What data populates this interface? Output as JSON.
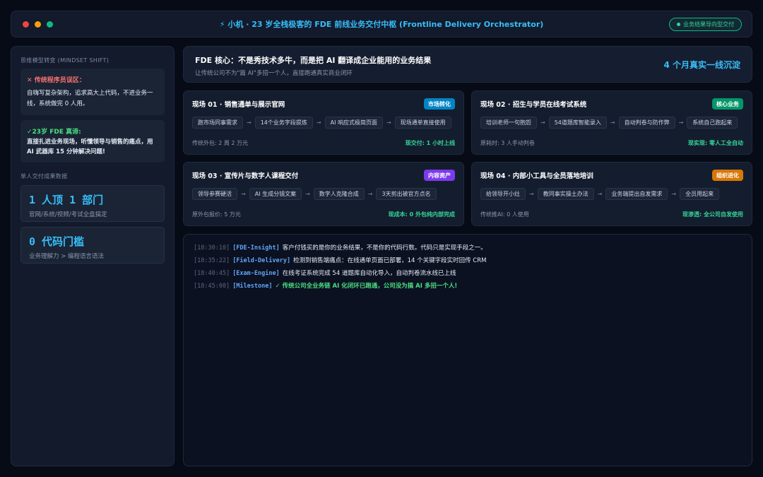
{
  "titlebar": {
    "dot_colors": [
      "#ef4444",
      "#f59e0b",
      "#10b981"
    ],
    "title": "小机 · 23 岁全栈极客的 FDE 前线业务交付中枢 (Frontline Delivery Orchestrator)",
    "title_icon": "lightning-icon",
    "badge": "业务结果导向型交付"
  },
  "sidebar": {
    "mindset_label": "思维模型转变 (MINDSET SHIFT)",
    "myth_title": "传统程序员误区：",
    "myth_body": "自嗨写复杂架构，追求高大上代码，不进业务一线，系统做完 0 人用。",
    "truth_title": "23岁 FDE 真谛:",
    "truth_body": "直接扎进业务现场，听懂领导与销售的痛点，用 AI 武器库 15 分钟解决问题!",
    "stats_label": "单人交付成果数据",
    "stats": [
      {
        "value": "1 人顶 1 部门",
        "sub": "官网/系统/视频/考试全盘搞定"
      },
      {
        "value": "0 代码门槛",
        "sub": "业务理解力 > 编程语言语法"
      }
    ]
  },
  "banner": {
    "title": "FDE 核心：不是秀技术多牛，而是把 AI 翻译成企业能用的业务结果",
    "subtitle": "让传统公司不为\"篇 AI\"多招一个人，直接跑通真实商业闭环",
    "right": "4 个月真实一线沉淀"
  },
  "cards": [
    {
      "title": "现场 01 · 销售通单与展示官网",
      "tag": "市场转化",
      "tag_color": "#0284c7",
      "steps": [
        "跑市场同事需求",
        "14个业务字段提炼",
        "AI 响应式极简页面",
        "现场通单直接使用"
      ],
      "foot_left": "传统外包: 2 周 2 万元",
      "foot_right": "现交付: 1 小时上线"
    },
    {
      "title": "现场 02 · 招生与学员在线考试系统",
      "tag": "核心业务",
      "tag_color": "#059669",
      "steps": [
        "培训老师一句抱怨",
        "54道题库智能录入",
        "自动判卷与防作弊",
        "系统自己跑起来"
      ],
      "foot_left": "原耗时: 3 人手动判卷",
      "foot_right": "现实现: 零人工全自动"
    },
    {
      "title": "现场 03 · 宣传片与数字人课程交付",
      "tag": "内容资产",
      "tag_color": "#7c3aed",
      "steps": [
        "领导参赛硬活",
        "AI 生成分镜文案",
        "数字人克隆合成",
        "3天剪出被官方点名"
      ],
      "foot_left": "原外包报价: 5 万元",
      "foot_right": "现成本: 0 外包纯内部完成"
    },
    {
      "title": "现场 04 · 内部小工具与全员落地培训",
      "tag": "组织进化",
      "tag_color": "#d97706",
      "steps": [
        "给领导开小灶",
        "教同事实操土办法",
        "业务端提出自发需求",
        "全员用起来"
      ],
      "foot_left": "传统推AI: 0 人使用",
      "foot_right": "现渗透: 全公司自发使用"
    }
  ],
  "console": {
    "lines": [
      {
        "time": "[18:30:10]",
        "tag": "[FDE-Insight]",
        "msg": "客户付钱买的是你的业务结果，不是你的代码行数。代码只是实现手段之一。",
        "ok": false
      },
      {
        "time": "[18:35:22]",
        "tag": "[Field-Delivery]",
        "msg": "检测到销售端痛点：在线通单页面已部署，14 个关键字段实时回传 CRM",
        "ok": false
      },
      {
        "time": "[18:40:45]",
        "tag": "[Exam-Engine]",
        "msg": "在线考证系统完成 54 道题库自动化导入，自动判卷流水线已上线",
        "ok": false
      },
      {
        "time": "[18:45:00]",
        "tag": "[Milestone]",
        "msg": "✓ 传统公司全业务链 AI 化闭环已跑通，公司没为搞 AI 多招一个人!",
        "ok": true
      }
    ]
  }
}
